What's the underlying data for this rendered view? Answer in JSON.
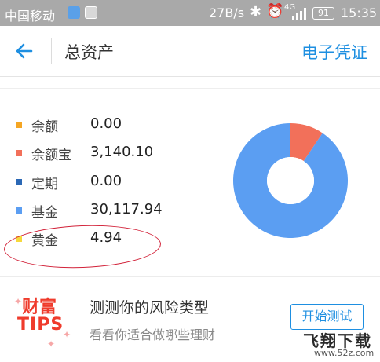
{
  "status_bar": {
    "carrier": "中国移动",
    "speed": "27B/s",
    "network": "4G",
    "battery": "91",
    "time": "15:35"
  },
  "nav": {
    "title": "总资产",
    "right_action": "电子凭证",
    "back_icon": "arrow-left-icon"
  },
  "assets": {
    "items": [
      {
        "label": "余额",
        "value": "0.00",
        "color": "#f5a623"
      },
      {
        "label": "余额宝",
        "value": "3,140.10",
        "color": "#f2705a"
      },
      {
        "label": "定期",
        "value": "0.00",
        "color": "#2b68b5"
      },
      {
        "label": "基金",
        "value": "30,117.94",
        "color": "#5b9ef2"
      },
      {
        "label": "黄金",
        "value": "4.94",
        "color": "#f6d83c"
      }
    ]
  },
  "chart_data": {
    "type": "pie",
    "categories": [
      "余额",
      "余额宝",
      "定期",
      "基金",
      "黄金"
    ],
    "values": [
      0.0,
      3140.1,
      0.0,
      30117.94,
      4.94
    ],
    "colors": [
      "#f5a623",
      "#f2705a",
      "#2b68b5",
      "#5b9ef2",
      "#f6d83c"
    ],
    "donut": true
  },
  "tips": {
    "logo_line1": "财富",
    "logo_line2": "TIPS",
    "title": "测测你的风险类型",
    "subtitle": "看看你适合做哪些理财",
    "button": "开始测试"
  },
  "watermark": {
    "main": "飞翔下载",
    "url": "www.52z.com"
  }
}
